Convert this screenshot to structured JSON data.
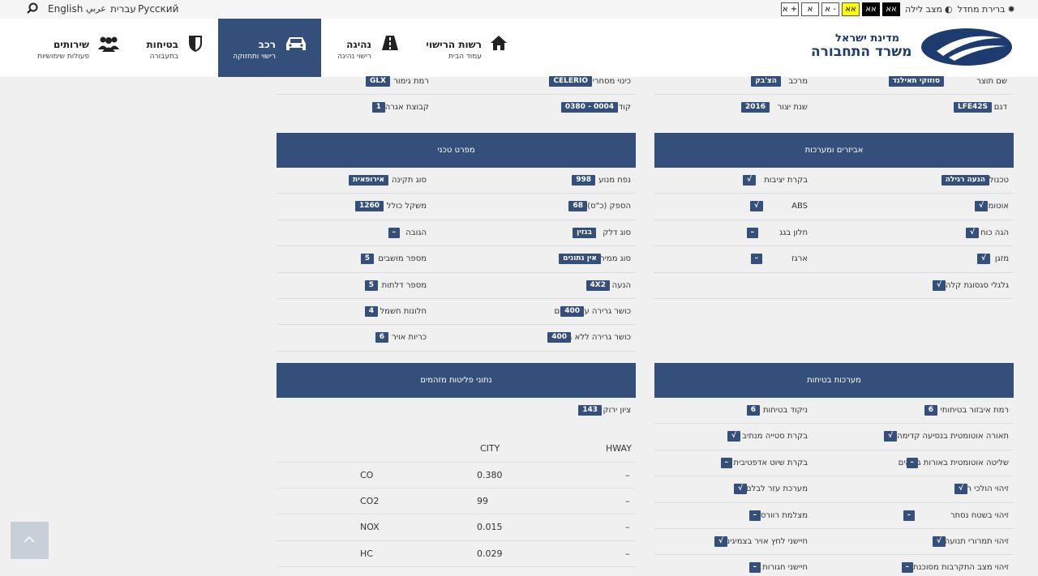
{
  "topbar": {
    "languages": [
      "English",
      "عربي",
      "עברית",
      "Русский"
    ],
    "accessibility": {
      "buttons": [
        "א +",
        "א",
        "א -",
        "אא",
        "אא",
        "אא"
      ],
      "night_mode": "מצב לילה",
      "default": "ברירת מחדל"
    }
  },
  "nav": {
    "logo_line1": "מדינת ישראל",
    "logo_line2": "משרד התחבורה",
    "items": [
      {
        "title": "רשות הרישוי",
        "sub": "עמוד הבית"
      },
      {
        "title": "נהיגה",
        "sub": "רישוי נהיגה"
      },
      {
        "title": "רכב",
        "sub": "רישוי ותחזוקה"
      },
      {
        "title": "בטיחות",
        "sub": "בתעבורה"
      },
      {
        "title": "שירותים",
        "sub": "פעולות שימושיות"
      }
    ]
  },
  "top_rows": {
    "right": [
      {
        "label": "שם תוצר",
        "value": "סוזוקי תאילנד"
      },
      {
        "label": "דגם",
        "value": "LFE42S"
      }
    ],
    "right_mid": [
      {
        "label": "מרכב",
        "value": "הצ'בק"
      },
      {
        "label": "שנת יצור",
        "value": "2016"
      }
    ],
    "left_mid": [
      {
        "label": "כינוי מסחרי",
        "value": "CELERIO"
      },
      {
        "label": "קוד",
        "value": "0380 - 0004"
      }
    ],
    "left": [
      {
        "label": "רמת גימור",
        "value": "GLX"
      },
      {
        "label": "קבוצת אגרה",
        "value": "1"
      }
    ]
  },
  "tech_spec": {
    "title": "מפרט טכני",
    "rows": [
      {
        "l1": "נפח מנוע",
        "v1": "998",
        "l2": "סוג תקינה",
        "v2": "אירופאית"
      },
      {
        "l1": "הספק (כ\"ס)",
        "v1": "68",
        "l2": "משקל כולל",
        "v2": "1260"
      },
      {
        "l1": "סוג דלק",
        "v1": "בנזין",
        "l2": "הגובה",
        "v2": "–"
      },
      {
        "l1": "סוג ממיר",
        "v1": "אין נתונים",
        "l2": "מספר מושבים",
        "v2": "5"
      },
      {
        "l1": "הנעה",
        "v1": "4X2",
        "l2": "מספר דלתות",
        "v2": "5"
      },
      {
        "l1": "כושר גרירה עם בלמים",
        "v1": "400",
        "l2": "חלונות חשמל",
        "v2": "4"
      },
      {
        "l1": "כושר גרירה ללא בלמים",
        "v1": "400",
        "l2": "כריות אויר",
        "v2": "6"
      }
    ]
  },
  "accessories": {
    "title": "אביזרים ומערכות",
    "rows": [
      {
        "l1": "טכנולוגיית הנעה",
        "v1": "הנעה רגילה",
        "l2": "בקרת יציבות",
        "v2": "√"
      },
      {
        "l1": "אוטומט",
        "v1": "√",
        "l2": "ABS",
        "v2": "√"
      },
      {
        "l1": "הגה כוח",
        "v1": "√",
        "l2": "חלון בגג",
        "v2": "–"
      },
      {
        "l1": "מזגן",
        "v1": "√",
        "l2": "ארגז",
        "v2": "–"
      },
      {
        "l1": "גלגלי סגסוגת קלה",
        "v1": "√",
        "l2": "",
        "v2": ""
      }
    ]
  },
  "emissions": {
    "title": "נתוני פליטות מזהמים",
    "green_label": "ציון ירוק",
    "green_value": "143",
    "columns": [
      "HWAY",
      "CITY"
    ],
    "rows": [
      {
        "name": "CO",
        "city": "0.380",
        "hway": "–"
      },
      {
        "name": "CO2",
        "city": "99",
        "hway": "–"
      },
      {
        "name": "NOX",
        "city": "0.015",
        "hway": "–"
      },
      {
        "name": "HC",
        "city": "0.029",
        "hway": "–"
      }
    ]
  },
  "safety": {
    "title": "מערכות בטיחות",
    "rows": [
      {
        "l1": "רמת איבזור בטיחותי",
        "v1": "6",
        "l2": "ניקוד בטיחות",
        "v2": "6"
      },
      {
        "l1": "תאורה אוטומטית בנסיעה קדימה",
        "v1": "√",
        "l2": "בקרת סטייה מנתיב",
        "v2": "√"
      },
      {
        "l1": "שליטה אוטומטית באורות גבוהים",
        "v1": "–",
        "l2": "בקרת שיוט אדפטיבית",
        "v2": "–"
      },
      {
        "l1": "זיהוי הולכי רגל",
        "v1": "√",
        "l2": "מערכת עזר לבלם",
        "v2": "√"
      },
      {
        "l1": "זיהוי בשטח נסתר",
        "v1": "–",
        "l2": "מצלמת רוורס",
        "v2": "–"
      },
      {
        "l1": "זיהוי תמרורי תנועה",
        "v1": "√",
        "l2": "חיישני לחץ אויר בצמיגים",
        "v2": "√"
      },
      {
        "l1": "זיהוי מצב התקרבות מסוכנת",
        "v1": "–",
        "l2": "חיישני חגורות",
        "v2": "–"
      }
    ]
  }
}
